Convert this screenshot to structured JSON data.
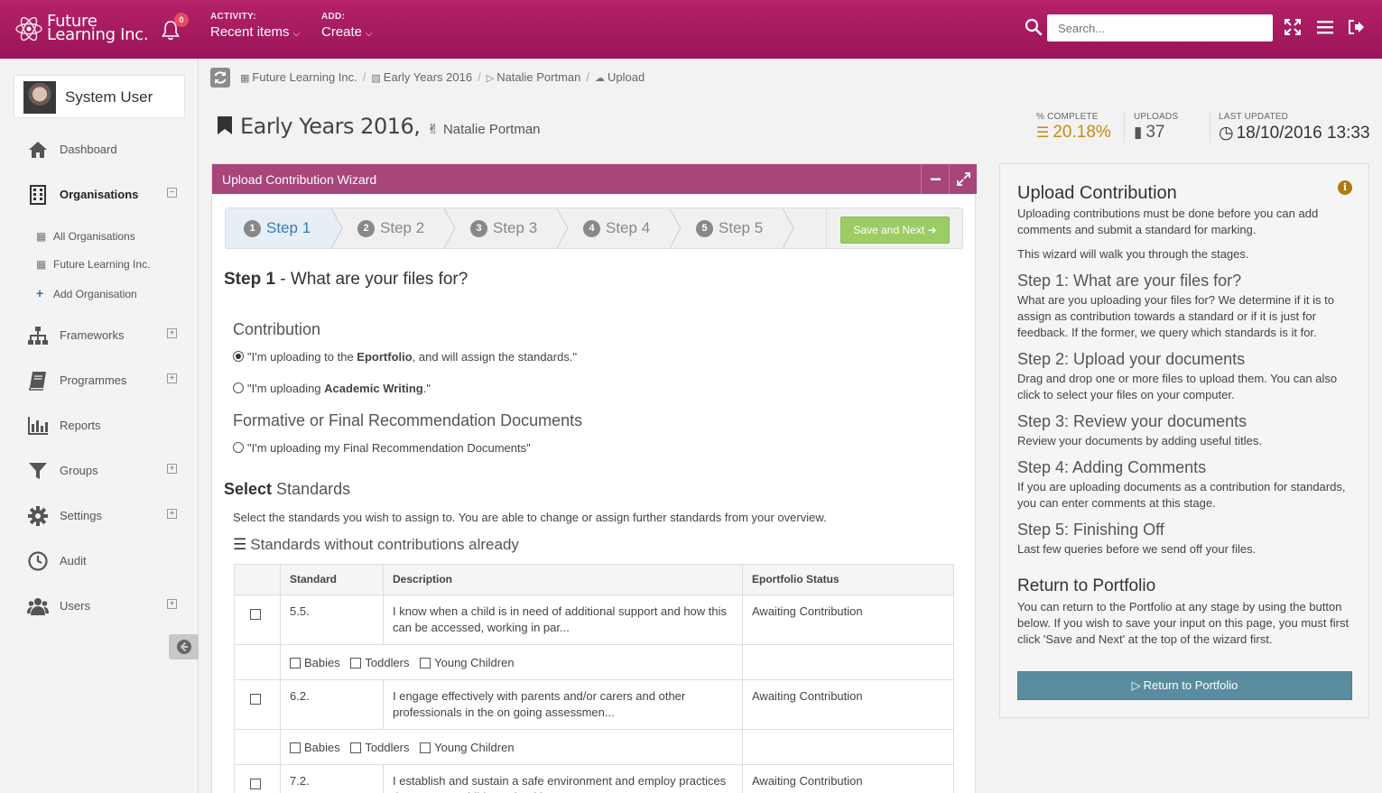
{
  "app": {
    "logo_line1": "Future",
    "logo_line2": "Learning Inc.",
    "notifications_count": "0",
    "activity_label": "ACTIVITY:",
    "activity_value": "Recent items",
    "add_label": "ADD:",
    "add_value": "Create",
    "search_placeholder": "Search...",
    "accent_color": "#a8457b"
  },
  "sidebar": {
    "user_name": "System User",
    "items": [
      {
        "label": "Dashboard",
        "icon": "home-icon"
      },
      {
        "label": "Organisations",
        "icon": "building-icon",
        "active": true
      },
      {
        "label": "Frameworks",
        "icon": "sitemap-icon"
      },
      {
        "label": "Programmes",
        "icon": "book-icon"
      },
      {
        "label": "Reports",
        "icon": "bar-chart-icon"
      },
      {
        "label": "Groups",
        "icon": "filter-icon"
      },
      {
        "label": "Settings",
        "icon": "gear-icon"
      },
      {
        "label": "Audit",
        "icon": "clock-icon"
      },
      {
        "label": "Users",
        "icon": "users-icon"
      }
    ],
    "sub_items": [
      {
        "label": "All Organisations"
      },
      {
        "label": "Future Learning Inc."
      },
      {
        "label": "Add Organisation"
      }
    ]
  },
  "breadcrumb": [
    "Future Learning Inc.",
    "Early Years 2016",
    "Natalie Portman",
    "Upload"
  ],
  "header": {
    "title": "Early Years 2016,",
    "learner": "Natalie Portman",
    "stats": [
      {
        "label": "% COMPLETE",
        "value": "20.18%",
        "color": "#c98a14"
      },
      {
        "label": "UPLOADS",
        "value": "37",
        "color": "#555555"
      },
      {
        "label": "LAST UPDATED",
        "value": "18/10/2016 13:33",
        "color": "#333333"
      }
    ]
  },
  "wizard": {
    "title": "Upload Contribution Wizard",
    "steps": [
      {
        "num": "1",
        "label": "Step 1"
      },
      {
        "num": "2",
        "label": "Step 2"
      },
      {
        "num": "3",
        "label": "Step 3"
      },
      {
        "num": "4",
        "label": "Step 4"
      },
      {
        "num": "5",
        "label": "Step 5"
      }
    ],
    "save_next_label": "Save and Next",
    "step_heading_bold": "Step 1",
    "step_heading_rest": " - What are your files for?",
    "contribution_label": "Contribution",
    "radio1_pre": "\"I'm uploading to the ",
    "radio1_bold": "Eportfolio",
    "radio1_post": ", and will assign the standards.\"",
    "radio2_pre": "\"I'm uploading ",
    "radio2_bold": "Academic Writing",
    "radio2_post": ".\"",
    "formative_label": "Formative or Final Recommendation Documents",
    "radio3": "\"I'm uploading my Final Recommendation Documents\"",
    "select_bold": "Select",
    "select_rest": " Standards",
    "select_desc": "Select the standards you wish to assign to. You are able to change or assign further standards from your overview.",
    "table_heading": "Standards without contributions already",
    "columns": [
      "Standard",
      "Description",
      "Eportfolio Status"
    ],
    "sub_options": [
      "Babies",
      "Toddlers",
      "Young Children"
    ],
    "rows": [
      {
        "standard": "5.5.",
        "description": "I know when a child is in need of additional support and how this can be accessed, working in par...",
        "status": "Awaiting Contribution"
      },
      {
        "standard": "6.2.",
        "description": "I engage effectively with parents and/or carers and other professionals in the on going assessmen...",
        "status": "Awaiting Contribution"
      },
      {
        "standard": "7.2.",
        "description": "I establish and sustain a safe environment and employ practices that promote children's health an...",
        "status": "Awaiting Contribution"
      }
    ]
  },
  "info": {
    "title": "Upload Contribution",
    "intro": "Uploading contributions must be done before you can add comments and submit a standard for marking.",
    "intro2": "This wizard will walk you through the stages.",
    "sections": [
      {
        "heading": "Step 1: What are your files for?",
        "text": "What are you uploading your files for? We determine if it is to assign as contribution towards a standard or if it is just for feedback. If the former, we query which standards is it for."
      },
      {
        "heading": "Step 2: Upload your documents",
        "text": "Drag and drop one or more files to upload them. You can also click to select your files on your computer."
      },
      {
        "heading": "Step 3: Review your documents",
        "text": "Review your documents by adding useful titles."
      },
      {
        "heading": "Step 4: Adding Comments",
        "text": "If you are uploading documents as a contribution for standards, you can enter comments at this stage."
      },
      {
        "heading": "Step 5: Finishing Off",
        "text": "Last few queries before we send off your files."
      }
    ],
    "return_heading": "Return to Portfolio",
    "return_text": "You can return to the Portfolio at any stage by using the button below. If you wish to save your input on this page, you must first click 'Save and Next' at the top of the wizard first.",
    "return_button": "Return to Portfolio"
  }
}
